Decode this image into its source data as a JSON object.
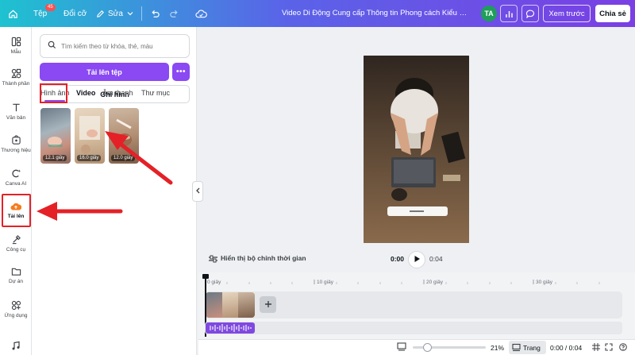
{
  "topbar": {
    "file_label": "Tệp",
    "file_badge": "45",
    "resize_label": "Đổi cỡ",
    "edit_label": "Sửa",
    "document_title": "Video Di Động Cung cấp Thông tin Phong cách Kiểu chữ Sá...",
    "avatar_initials": "TA",
    "preview_label": "Xem trước",
    "share_label": "Chia sẻ"
  },
  "rail": {
    "items": [
      {
        "label": "Mẫu",
        "icon": "template-icon"
      },
      {
        "label": "Thành phần",
        "icon": "elements-icon"
      },
      {
        "label": "Văn bản",
        "icon": "text-icon"
      },
      {
        "label": "Thương hiệu",
        "icon": "brand-icon"
      },
      {
        "label": "Canva AI",
        "icon": "canva-ai-icon"
      },
      {
        "label": "Tải lên",
        "icon": "upload-cloud-icon",
        "active": true
      },
      {
        "label": "Công cụ",
        "icon": "tools-icon"
      },
      {
        "label": "Dự án",
        "icon": "folder-icon"
      },
      {
        "label": "Ứng dụng",
        "icon": "apps-icon"
      }
    ]
  },
  "panel": {
    "search_placeholder": "Tìm kiếm theo từ khóa, thẻ, màu",
    "upload_button": "Tải lên tệp",
    "more_button": "•••",
    "record_button": "Ghi hình",
    "tabs": [
      {
        "label": "Hình ảnh",
        "active": false
      },
      {
        "label": "Video",
        "active": true
      },
      {
        "label": "Âm thanh",
        "active": false
      },
      {
        "label": "Thư mục",
        "active": false
      }
    ],
    "videos": [
      {
        "duration": "12.1 giây"
      },
      {
        "duration": "16.0 giây"
      },
      {
        "duration": "12.0 giây"
      }
    ]
  },
  "player": {
    "show_timing": "Hiển thị bộ chỉnh thời gian",
    "current_time": "0:00",
    "total_time": "0:04"
  },
  "timeline": {
    "ruler": [
      "0 giây",
      "10 giây",
      "20 giây",
      "30 giây"
    ]
  },
  "bottombar": {
    "zoom": "21%",
    "pages_label": "Trang",
    "time_readout": "0:00 / 0:04"
  },
  "colors": {
    "accent": "#8a49f2",
    "annotation": "#e42127"
  }
}
